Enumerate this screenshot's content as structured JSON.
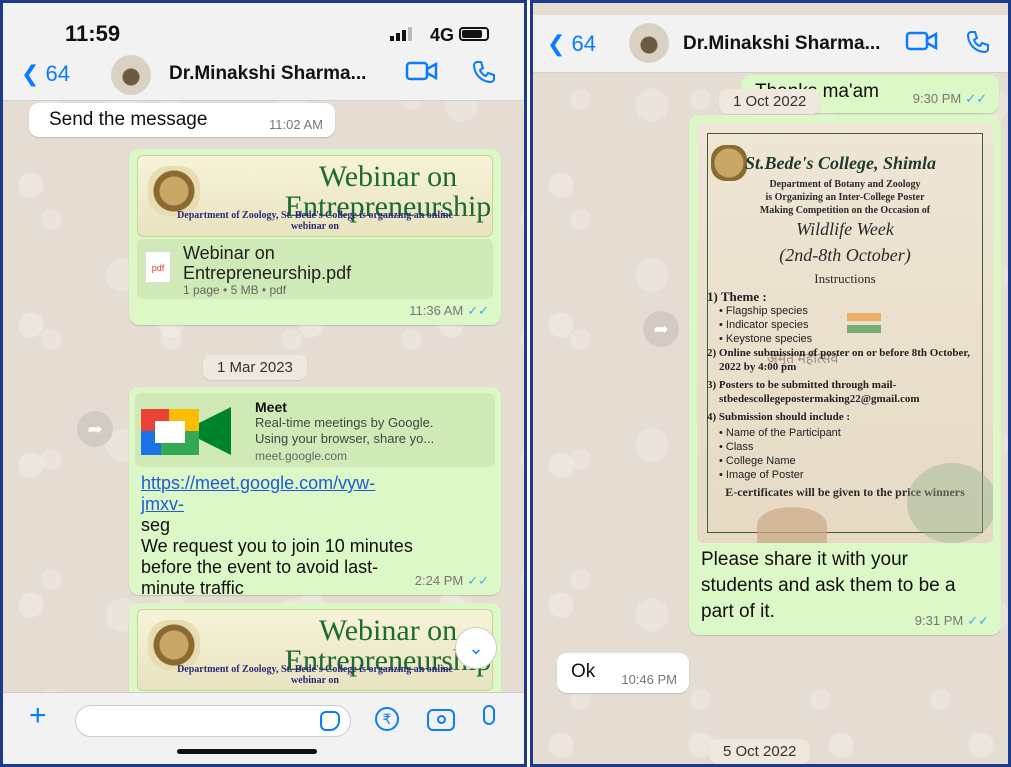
{
  "left": {
    "status": {
      "time": "11:59",
      "network": "4G"
    },
    "header": {
      "back_count": "64",
      "contact": "Dr.Minakshi Sharma...",
      "back_icon": "chevron-left-icon",
      "video_icon": "video-camera-icon",
      "phone_icon": "phone-icon"
    },
    "messages": {
      "m1": {
        "text": "Send the message",
        "time": "11:02 AM"
      },
      "webinar": {
        "title_l1": "Webinar on",
        "title_l2": "Entrepreneurship",
        "dept": "Department of Zoology, St. Bede's College is organzing an online",
        "dept2": "webinar on"
      },
      "pdf": {
        "badge": "pdf",
        "name_l1": "Webinar on",
        "name_l2": "Entrepreneurship.pdf",
        "meta": "1 page • 5 MB • pdf",
        "time": "11:36 AM"
      },
      "date": "1 Mar 2023",
      "meet": {
        "title": "Meet",
        "desc_l1": "Real-time meetings by Google.",
        "desc_l2": "Using your browser, share yo...",
        "domain": "meet.google.com",
        "link_l1": "https://meet.google.com/vyw-",
        "link_l2": "jmxv-",
        "line3": "seg",
        "body_l1": "We request you to join 10 minutes",
        "body_l2": "before the event to avoid last-",
        "body_l3": "minute traffic",
        "time": "2:24 PM"
      },
      "webinar2": {
        "title_l1": "Webinar on",
        "title_l2": "Entrepreneurship",
        "dept": "Department of Zoology, St. Bede's College is organzing an online",
        "dept2": "webinar on"
      }
    },
    "inputbar": {
      "plus_icon": "plus-icon",
      "sticker_icon": "sticker-icon",
      "rupee_icon": "rupee-icon",
      "camera_icon": "camera-icon",
      "mic_icon": "microphone-icon"
    }
  },
  "right": {
    "header": {
      "back_count": "64",
      "contact": "Dr.Minakshi Sharma..."
    },
    "messages": {
      "thanks": {
        "text": "Thanks ma'am",
        "time": "9:30 PM"
      },
      "date_top": "1 Oct 2022",
      "poster": {
        "college": "St.Bede's College, Shimla",
        "dept_l1": "Department of Botany and Zoology",
        "dept_l2": "is Organizing an Inter-College Poster",
        "dept_l3": "Making Competition on the Occasion of",
        "event": "Wildlife Week",
        "dates": "(2nd-8th October)",
        "instructions": "Instructions",
        "theme": "1) Theme :",
        "t1": "• Flagship species",
        "t2": "• Indicator species",
        "t3": "• Keystone species",
        "sub_l1": "2) Online submission of poster on or before 8th October,",
        "sub_l2": "2022 by 4:00 pm",
        "mail_l1": "3) Posters to be submitted through mail-",
        "mail_l2": "stbedescollegepostermaking22@gmail.com",
        "incl": "4) Submission should include :",
        "i1": "• Name of the Participant",
        "i2": "• Class",
        "i3": "• College Name",
        "i4": "• Image of Poster",
        "cert": "E-certificates will be given to the price winners",
        "watermark": "अमृत महोत्सव"
      },
      "share": {
        "l1": "Please share it with your",
        "l2": "students and ask them to be a",
        "l3": "part of it.",
        "time": "9:31 PM"
      },
      "ok": {
        "text": "Ok",
        "time": "10:46 PM"
      },
      "date_bottom": "5 Oct 2022"
    }
  },
  "colors": {
    "accent": "#0a7cff",
    "outgoing": "#dcf8c6",
    "incoming": "#ffffff",
    "frame": "#1e3a8a"
  }
}
